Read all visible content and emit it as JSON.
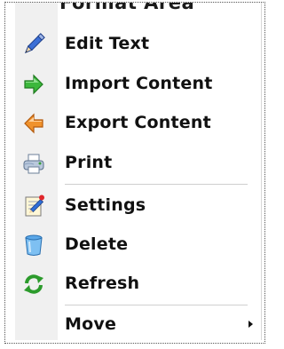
{
  "menu": {
    "cutoff_text": "Format Area",
    "items": [
      {
        "label": "Edit Text",
        "icon": "pencil-icon"
      },
      {
        "label": "Import Content",
        "icon": "green-arrow-right-icon"
      },
      {
        "label": "Export Content",
        "icon": "orange-arrow-left-icon"
      },
      {
        "label": "Print",
        "icon": "printer-icon"
      },
      {
        "label": "Settings",
        "icon": "settings-notepad-icon"
      },
      {
        "label": "Delete",
        "icon": "trash-can-icon"
      },
      {
        "label": "Refresh",
        "icon": "refresh-icon"
      },
      {
        "label": "Move",
        "icon": "",
        "submenu": true
      }
    ]
  }
}
